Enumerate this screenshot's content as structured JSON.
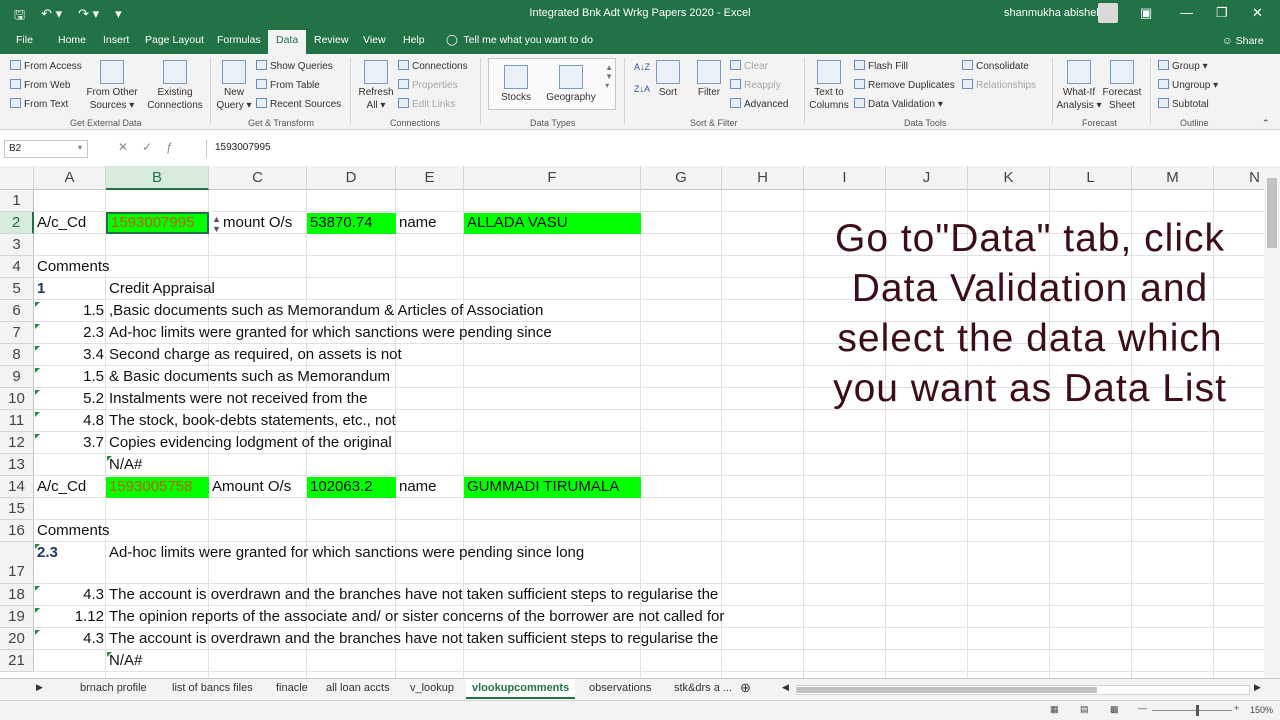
{
  "window": {
    "title": "Integrated Bnk Adt Wrkg Papers 2020  -  Excel",
    "user": "shanmukha abishek"
  },
  "tabs": [
    "File",
    "Home",
    "Insert",
    "Page Layout",
    "Formulas",
    "Data",
    "Review",
    "View",
    "Help"
  ],
  "active_tab": "Data",
  "tell_me": "Tell me what you want to do",
  "share": "Share",
  "ribbon": {
    "get_external": {
      "from_access": "From Access",
      "from_web": "From Web",
      "from_text": "From Text",
      "from_other": "From Other",
      "sources": "Sources",
      "existing": "Existing",
      "connections": "Connections",
      "label": "Get External Data"
    },
    "get_transform": {
      "new": "New",
      "query": "Query",
      "show_queries": "Show Queries",
      "from_table": "From Table",
      "recent_sources": "Recent Sources",
      "label": "Get & Transform"
    },
    "connections": {
      "refresh": "Refresh",
      "all": "All",
      "connections": "Connections",
      "properties": "Properties",
      "edit_links": "Edit Links",
      "label": "Connections"
    },
    "data_types": {
      "stocks": "Stocks",
      "geography": "Geography",
      "label": "Data Types"
    },
    "sort_filter": {
      "sort": "Sort",
      "filter": "Filter",
      "clear": "Clear",
      "reapply": "Reapply",
      "advanced": "Advanced",
      "label": "Sort & Filter"
    },
    "data_tools": {
      "text_to": "Text to",
      "columns": "Columns",
      "flash_fill": "Flash Fill",
      "remove_duplicates": "Remove Duplicates",
      "data_validation": "Data Validation",
      "consolidate": "Consolidate",
      "relationships": "Relationships",
      "label": "Data Tools"
    },
    "forecast": {
      "whatif": "What-If",
      "analysis": "Analysis",
      "forecast": "Forecast",
      "sheet": "Sheet",
      "label": "Forecast"
    },
    "outline": {
      "group": "Group",
      "ungroup": "Ungroup",
      "subtotal": "Subtotal",
      "label": "Outline"
    }
  },
  "name_box": "B2",
  "formula": "1593007995",
  "columns": [
    "A",
    "B",
    "C",
    "D",
    "E",
    "F",
    "G",
    "H",
    "I",
    "J",
    "K",
    "L",
    "M",
    "N"
  ],
  "rows": [
    "1",
    "2",
    "3",
    "4",
    "5",
    "6",
    "7",
    "8",
    "9",
    "10",
    "11",
    "12",
    "13",
    "14",
    "15",
    "16",
    "17",
    "18",
    "19",
    "20",
    "21"
  ],
  "cells": {
    "a2": "A/c_Cd",
    "b2": "1593007995",
    "c2": "mount O/s",
    "d2": "53870.74",
    "e2": "name",
    "f2": "ALLADA  VASU",
    "a4": "Comments",
    "a5": "1",
    "b5": "Credit Appraisal",
    "a6": "1.5",
    "b6": " ,Basic documents such as Memorandum & Articles of Association",
    "a7": "2.3",
    "b7": " Ad-hoc limits were granted for which sanctions were pending since",
    "a8": "3.4",
    "b8": " Second charge as required, on assets is not",
    "a9": "1.5",
    "b9": " & Basic documents such as Memorandum",
    "a10": "5.2",
    "b10": " Instalments were not received from the",
    "a11": "4.8",
    "b11": " The stock, book-debts statements, etc., not",
    "a12": "3.7",
    "b12": " Copies evidencing lodgment of the original",
    "b13": "N/A#",
    "a14": "A/c_Cd",
    "b14": "1593005758",
    "c14": "Amount O/s",
    "d14": "102063.2",
    "e14": "name",
    "f14": "GUMMADI TIRUMALA",
    "a16": "Comments",
    "a17": "2.3",
    "b17": "Ad-hoc limits were granted for which sanctions were pending since long",
    "a18": "4.3",
    "b18": " The account is overdrawn and the branches have not taken sufficient steps to regularise the",
    "a19": "1.12",
    "b19": "The opinion reports of the associate and/ or sister concerns of the borrower are not called for",
    "a20": "4.3",
    "b20": " The account is overdrawn and the branches have not taken sufficient steps to regularise the",
    "b21": "N/A#"
  },
  "annotation": "Go to\"Data\" tab, click Data Validation and select the data which you want as Data List",
  "sheets": [
    "brnach profile",
    "list of bancs files",
    "finacle",
    "all loan accts",
    "v_lookup",
    "vlookupcomments",
    "observations",
    "stk&drs a ..."
  ],
  "active_sheet": "vlookupcomments",
  "zoom": "150%"
}
